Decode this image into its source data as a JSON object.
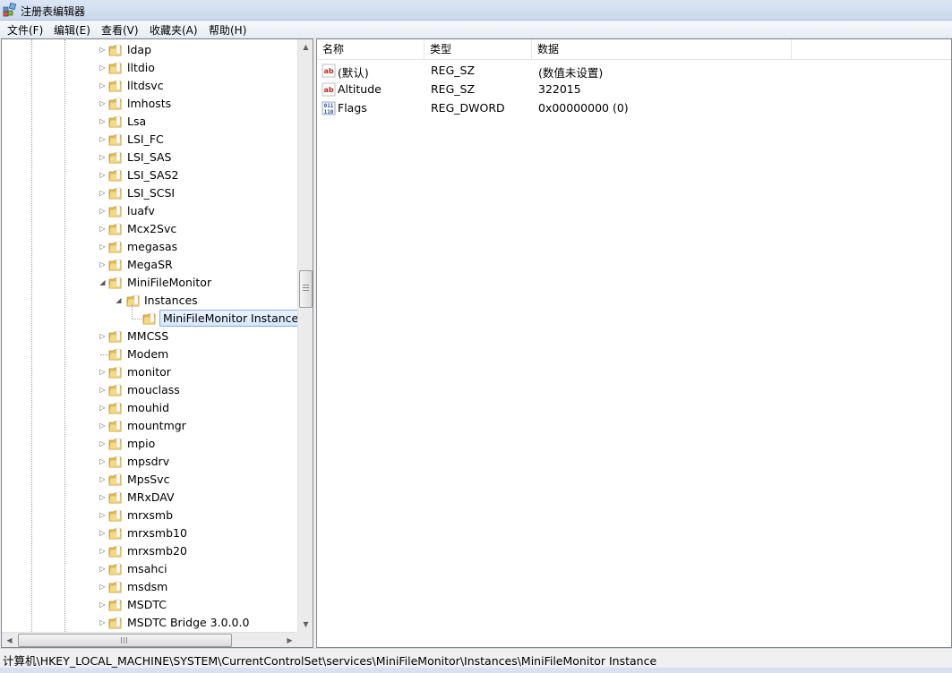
{
  "window": {
    "title": "注册表编辑器"
  },
  "menu": [
    "文件(F)",
    "编辑(E)",
    "查看(V)",
    "收藏夹(A)",
    "帮助(H)"
  ],
  "tree": {
    "items": [
      {
        "label": "ldap",
        "level": 0,
        "expander": "collapsed"
      },
      {
        "label": "lltdio",
        "level": 0,
        "expander": "collapsed"
      },
      {
        "label": "lltdsvc",
        "level": 0,
        "expander": "collapsed"
      },
      {
        "label": "lmhosts",
        "level": 0,
        "expander": "collapsed"
      },
      {
        "label": "Lsa",
        "level": 0,
        "expander": "collapsed"
      },
      {
        "label": "LSI_FC",
        "level": 0,
        "expander": "collapsed"
      },
      {
        "label": "LSI_SAS",
        "level": 0,
        "expander": "collapsed"
      },
      {
        "label": "LSI_SAS2",
        "level": 0,
        "expander": "collapsed"
      },
      {
        "label": "LSI_SCSI",
        "level": 0,
        "expander": "collapsed"
      },
      {
        "label": "luafv",
        "level": 0,
        "expander": "collapsed"
      },
      {
        "label": "Mcx2Svc",
        "level": 0,
        "expander": "collapsed"
      },
      {
        "label": "megasas",
        "level": 0,
        "expander": "collapsed"
      },
      {
        "label": "MegaSR",
        "level": 0,
        "expander": "collapsed"
      },
      {
        "label": "MiniFileMonitor",
        "level": 0,
        "expander": "expanded"
      },
      {
        "label": "Instances",
        "level": 1,
        "expander": "expanded"
      },
      {
        "label": "MiniFileMonitor Instance",
        "level": 2,
        "expander": "none",
        "selected": true
      },
      {
        "label": "MMCSS",
        "level": 0,
        "expander": "collapsed"
      },
      {
        "label": "Modem",
        "level": 0,
        "expander": "none"
      },
      {
        "label": "monitor",
        "level": 0,
        "expander": "collapsed"
      },
      {
        "label": "mouclass",
        "level": 0,
        "expander": "collapsed"
      },
      {
        "label": "mouhid",
        "level": 0,
        "expander": "collapsed"
      },
      {
        "label": "mountmgr",
        "level": 0,
        "expander": "collapsed"
      },
      {
        "label": "mpio",
        "level": 0,
        "expander": "collapsed"
      },
      {
        "label": "mpsdrv",
        "level": 0,
        "expander": "collapsed"
      },
      {
        "label": "MpsSvc",
        "level": 0,
        "expander": "collapsed"
      },
      {
        "label": "MRxDAV",
        "level": 0,
        "expander": "collapsed"
      },
      {
        "label": "mrxsmb",
        "level": 0,
        "expander": "collapsed"
      },
      {
        "label": "mrxsmb10",
        "level": 0,
        "expander": "collapsed"
      },
      {
        "label": "mrxsmb20",
        "level": 0,
        "expander": "collapsed"
      },
      {
        "label": "msahci",
        "level": 0,
        "expander": "collapsed"
      },
      {
        "label": "msdsm",
        "level": 0,
        "expander": "collapsed"
      },
      {
        "label": "MSDTC",
        "level": 0,
        "expander": "collapsed"
      },
      {
        "label": "MSDTC Bridge 3.0.0.0",
        "level": 0,
        "expander": "collapsed"
      }
    ]
  },
  "list": {
    "columns": [
      "名称",
      "类型",
      "数据"
    ],
    "rows": [
      {
        "icon": "string-value-icon",
        "name": "(默认)",
        "type": "REG_SZ",
        "data": "(数值未设置)"
      },
      {
        "icon": "string-value-icon",
        "name": "Altitude",
        "type": "REG_SZ",
        "data": "322015"
      },
      {
        "icon": "binary-value-icon",
        "name": "Flags",
        "type": "REG_DWORD",
        "data": "0x00000000 (0)"
      }
    ]
  },
  "status": {
    "path": "计算机\\HKEY_LOCAL_MACHINE\\SYSTEM\\CurrentControlSet\\services\\MiniFileMonitor\\Instances\\MiniFileMonitor Instance"
  },
  "colors": {
    "selection_border": "#84acdd",
    "folder": "#e8c15a",
    "title_gradient": "#c9d8ec"
  }
}
